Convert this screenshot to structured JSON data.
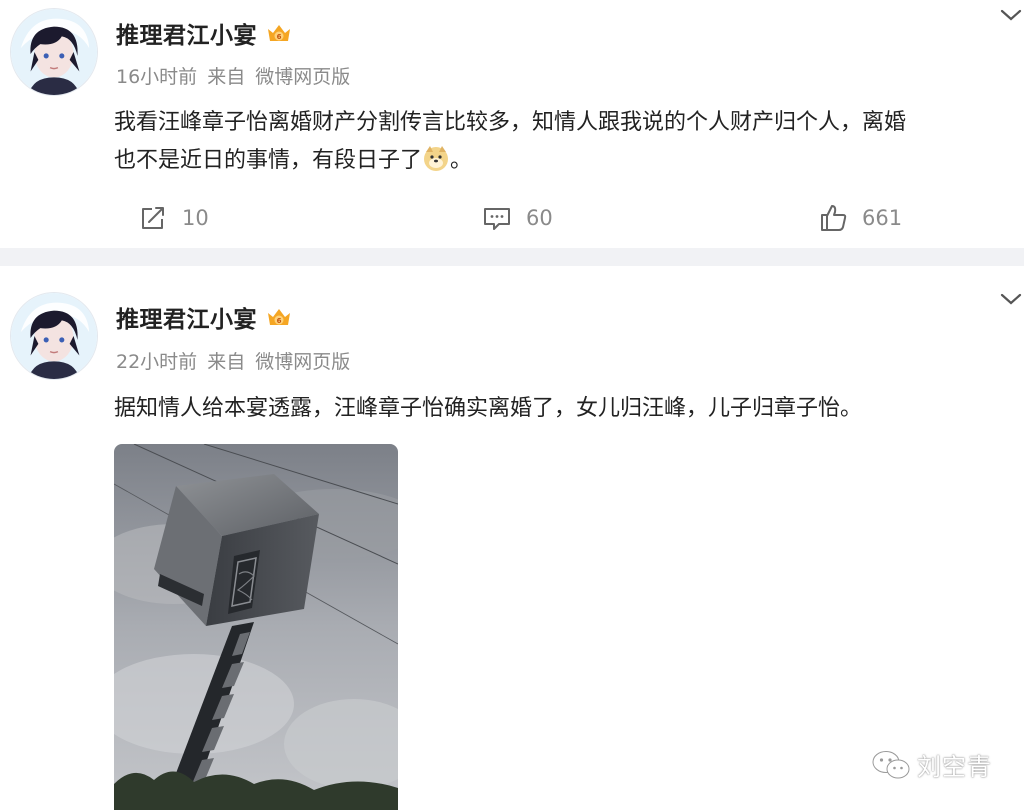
{
  "posts": [
    {
      "username": "推理君江小宴",
      "time": "16小时前",
      "source_prefix": "来自",
      "source": "微博网页版",
      "text_line1": "我看汪峰章子怡离婚财产分割传言比较多，知情人跟我说的个人财产归个人，离婚",
      "text_line2": "也不是近日的事情，有段日子了",
      "text_line2_end": "。",
      "emoji": "doge-emoji",
      "reposts": "10",
      "comments": "60",
      "likes": "661"
    },
    {
      "username": "推理君江小宴",
      "time": "22小时前",
      "source_prefix": "来自",
      "source": "微博网页版",
      "text_line1": "据知情人给本宴透露，汪峰章子怡确实离婚了，女儿归汪峰，儿子归章子怡。",
      "image": "hammer-photo"
    }
  ],
  "watermark": {
    "text": "刘空青",
    "icon": "wechat-icon"
  },
  "colors": {
    "accent": "#f5a623",
    "text": "#222222",
    "meta": "#8a8a8a",
    "separator": "#f1f2f5"
  },
  "icons": {
    "repost": "repost-icon",
    "comment": "comment-icon",
    "like": "like-icon",
    "dropdown": "chevron-down-icon",
    "vip": "vip-crown-icon"
  }
}
